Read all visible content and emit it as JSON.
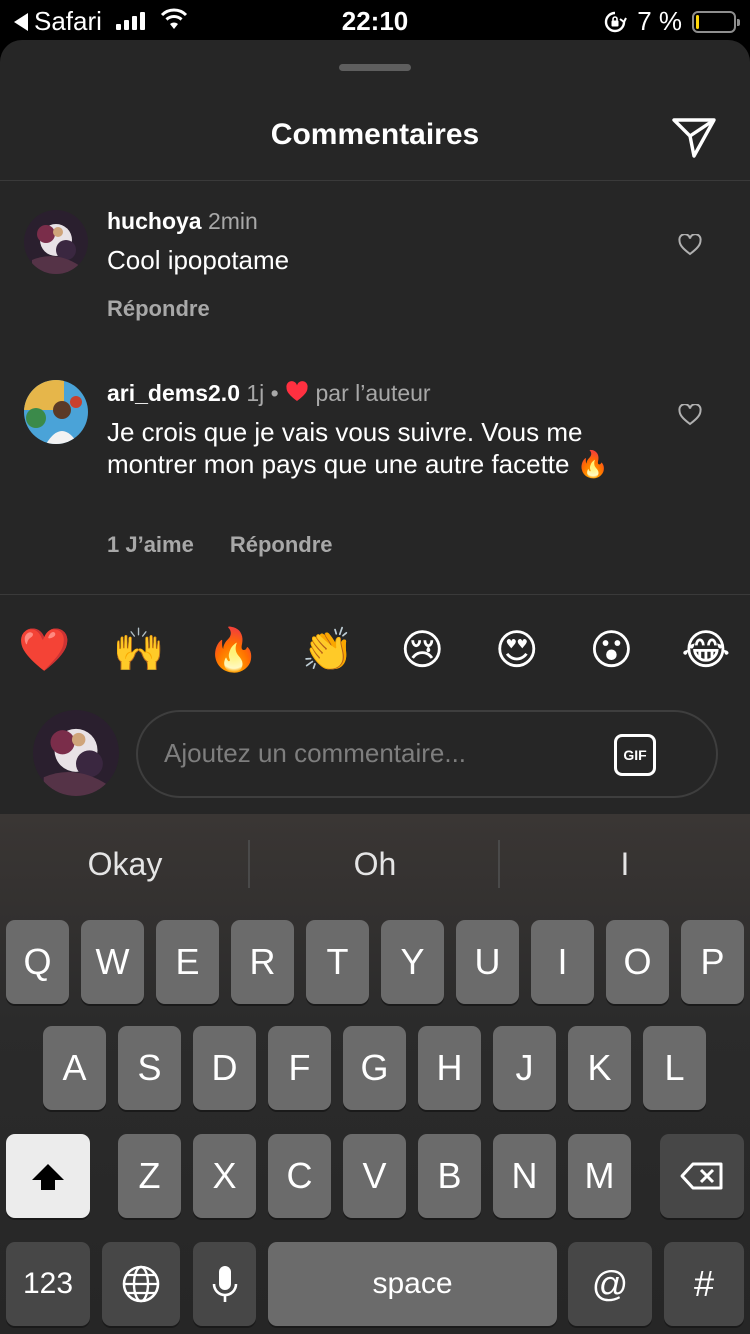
{
  "status_bar": {
    "back_label": "Safari",
    "time": "22:10",
    "battery_percent_label": "7 %",
    "battery_level": 0.07
  },
  "sheet": {
    "title": "Commentaires"
  },
  "comments": [
    {
      "username": "huchoya",
      "time": "2min",
      "text": "Cool ipopotame",
      "reply_label": "Répondre"
    },
    {
      "username": "ari_dems2.0",
      "time": "1j",
      "separator": "•",
      "liked_by_author_label": "par l’auteur",
      "text": "Je crois que je vais vous suivre. Vous me montrer mon pays que une autre facette 🔥",
      "likes_label": "1 J’aime",
      "reply_label": "Répondre"
    }
  ],
  "emoji_bar": [
    "❤️",
    "🙌",
    "🔥",
    "👏",
    "😢",
    "😍",
    "😮",
    "😂"
  ],
  "comment_input": {
    "placeholder": "Ajoutez un commentaire...",
    "gif_label": "GIF"
  },
  "keyboard": {
    "suggestions": [
      "Okay",
      "Oh",
      "I"
    ],
    "row1": [
      "Q",
      "W",
      "E",
      "R",
      "T",
      "Y",
      "U",
      "I",
      "O",
      "P"
    ],
    "row2": [
      "A",
      "S",
      "D",
      "F",
      "G",
      "H",
      "J",
      "K",
      "L"
    ],
    "row3": [
      "Z",
      "X",
      "C",
      "V",
      "B",
      "N",
      "M"
    ],
    "numbers_label": "123",
    "space_label": "space",
    "at_label": "@",
    "hash_label": "#"
  }
}
